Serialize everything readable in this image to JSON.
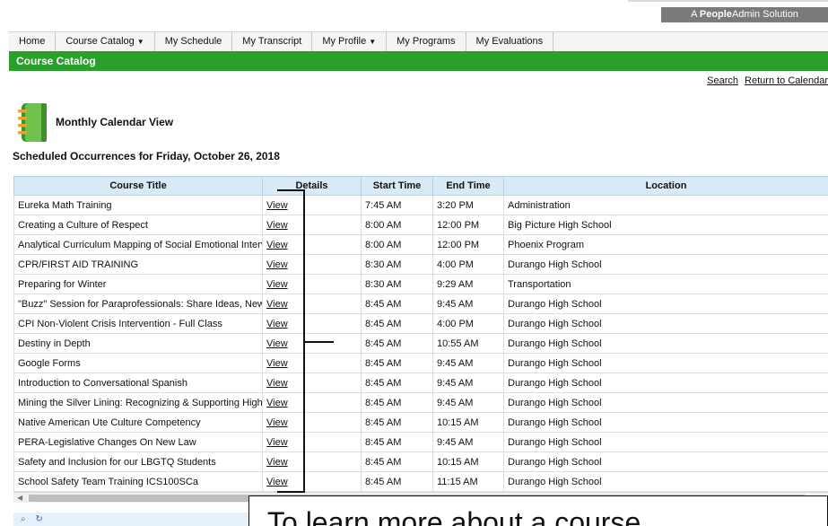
{
  "brand": {
    "prefix": "A ",
    "bold": "People",
    "rest": "Admin Solution"
  },
  "nav": {
    "items": [
      {
        "name": "nav-home",
        "label": "Home",
        "caret": false
      },
      {
        "name": "nav-course-catalog",
        "label": "Course Catalog",
        "caret": true
      },
      {
        "name": "nav-my-schedule",
        "label": "My Schedule",
        "caret": false
      },
      {
        "name": "nav-my-transcript",
        "label": "My Transcript",
        "caret": false
      },
      {
        "name": "nav-my-profile",
        "label": "My Profile",
        "caret": true
      },
      {
        "name": "nav-my-programs",
        "label": "My Programs",
        "caret": false
      },
      {
        "name": "nav-my-evaluations",
        "label": "My Evaluations",
        "caret": false
      }
    ],
    "caret_glyph": "▼"
  },
  "section": {
    "title": "Course Catalog"
  },
  "links": {
    "search": "Search",
    "return": "Return to Calendar"
  },
  "calendar": {
    "title": "Monthly Calendar View"
  },
  "heading": "Scheduled Occurrences for Friday, October 26, 2018",
  "table": {
    "headers": [
      "Course Title",
      "Details",
      "Start Time",
      "End Time",
      "Location"
    ],
    "rows": [
      [
        "Eureka Math Training",
        "View",
        "7:45 AM",
        "3:20 PM",
        "Administration"
      ],
      [
        "Creating a Culture of Respect",
        "View",
        "8:00 AM",
        "12:00 PM",
        "Big Picture High School"
      ],
      [
        "Analytical Curriculum Mapping of Social Emotional Interve",
        "View",
        "8:00 AM",
        "12:00 PM",
        "Phoenix Program"
      ],
      [
        "CPR/FIRST AID TRAINING",
        "View",
        "8:30 AM",
        "4:00 PM",
        "Durango High School"
      ],
      [
        "Preparing for Winter",
        "View",
        "8:30 AM",
        "9:29 AM",
        "Transportation"
      ],
      [
        "\"Buzz\" Session for Paraprofessionals: Share Ideas, New",
        "View",
        "8:45 AM",
        "9:45 AM",
        "Durango High School"
      ],
      [
        "CPI Non-Violent Crisis Intervention - Full Class",
        "View",
        "8:45 AM",
        "4:00 PM",
        "Durango High School"
      ],
      [
        "Destiny in Depth",
        "View",
        "8:45 AM",
        "10:55 AM",
        "Durango High School"
      ],
      [
        "Google Forms",
        "View",
        "8:45 AM",
        "9:45 AM",
        "Durango High School"
      ],
      [
        "Introduction to Conversational Spanish",
        "View",
        "8:45 AM",
        "9:45 AM",
        "Durango High School"
      ],
      [
        "Mining the Silver Lining: Recognizing & Supporting High /",
        "View",
        "8:45 AM",
        "9:45 AM",
        "Durango High School"
      ],
      [
        "Native American Ute Culture Competency",
        "View",
        "8:45 AM",
        "10:15 AM",
        "Durango High School"
      ],
      [
        "PERA-Legislative Changes On New Law",
        "View",
        "8:45 AM",
        "9:45 AM",
        "Durango High School"
      ],
      [
        "Safety and Inclusion for our LBGTQ Students",
        "View",
        "8:45 AM",
        "10:15 AM",
        "Durango High School"
      ],
      [
        "School Safety Team Training ICS100SCa",
        "View",
        "8:45 AM",
        "11:15 AM",
        "Durango High School"
      ]
    ]
  },
  "scrollbar": {
    "left_arrow": "◀"
  },
  "pager": {
    "search_icon": "⌕",
    "refresh_icon": "↻"
  },
  "callout": {
    "text": "To learn more about a course,"
  },
  "colors": {
    "section_green": "#2aa02a",
    "header_blue": "#d9eaf7",
    "brand_gray": "#7a7a7a"
  }
}
